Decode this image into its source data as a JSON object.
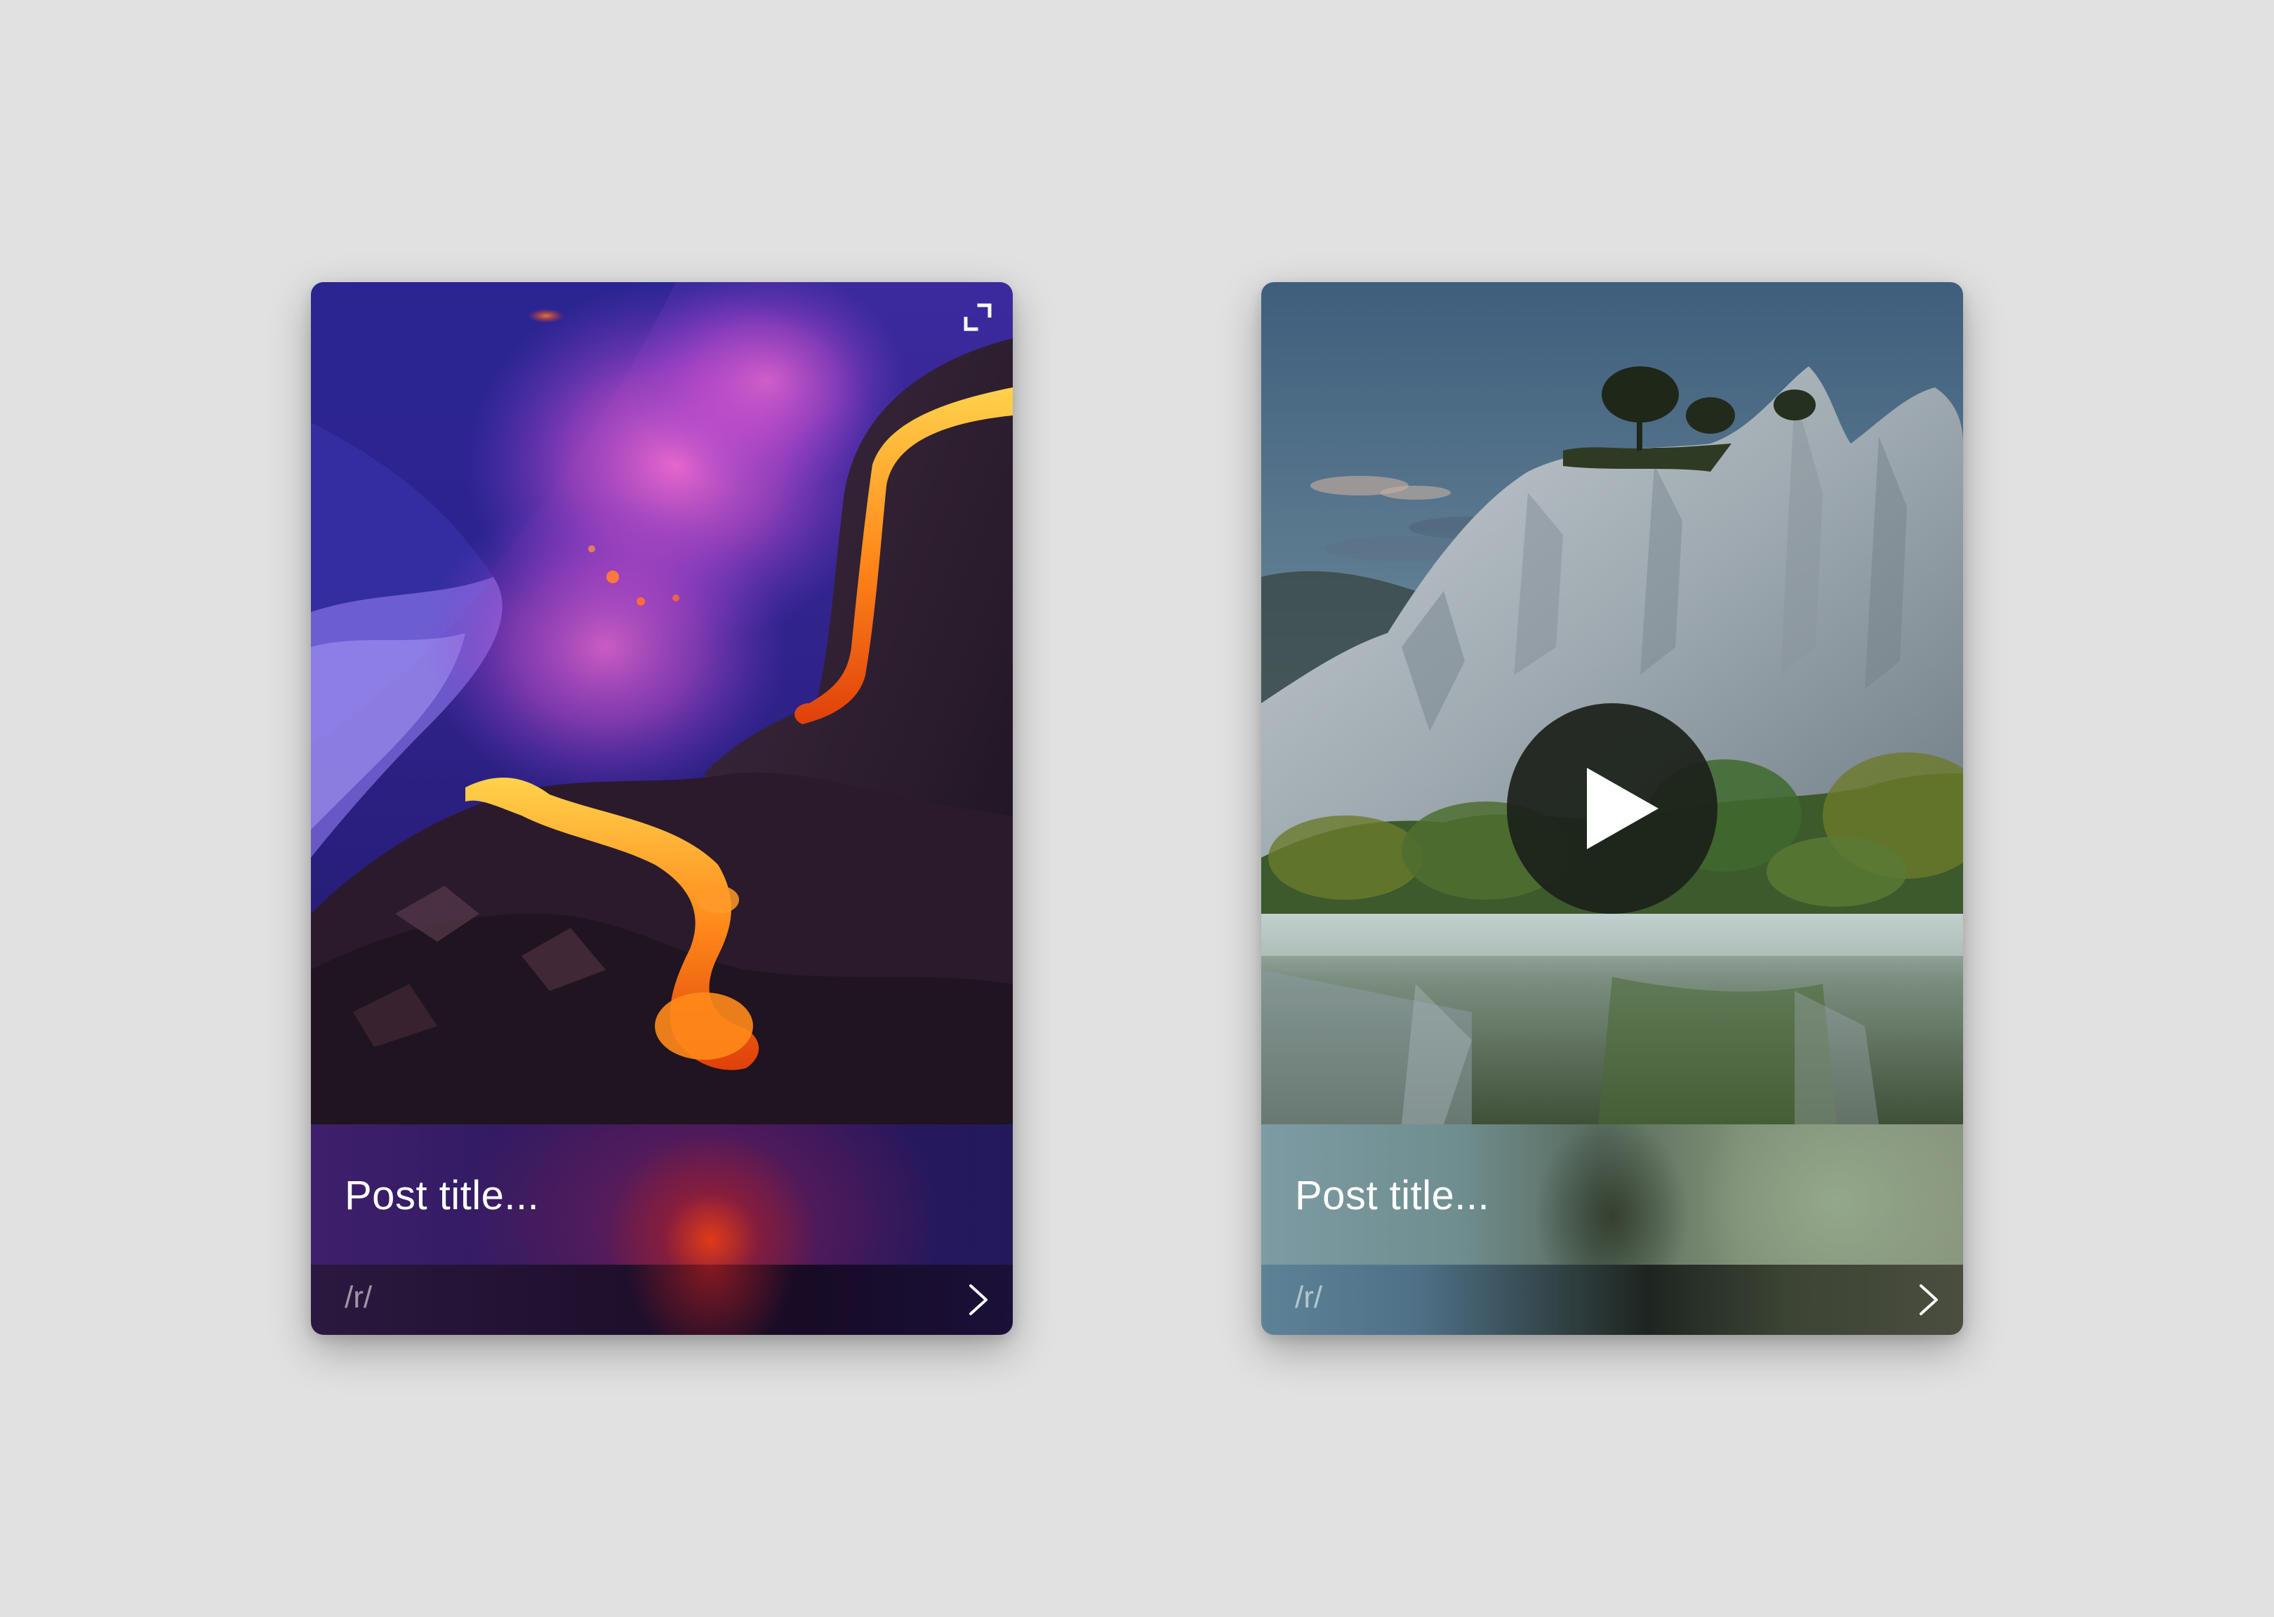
{
  "cards": [
    {
      "title": "Post title...",
      "subreddit": "/r/",
      "media_type": "image",
      "icons": [
        "expand-icon",
        "chevron-right-icon"
      ]
    },
    {
      "title": "Post title...",
      "subreddit": "/r/",
      "media_type": "video",
      "icons": [
        "play-icon",
        "chevron-right-icon"
      ]
    }
  ]
}
